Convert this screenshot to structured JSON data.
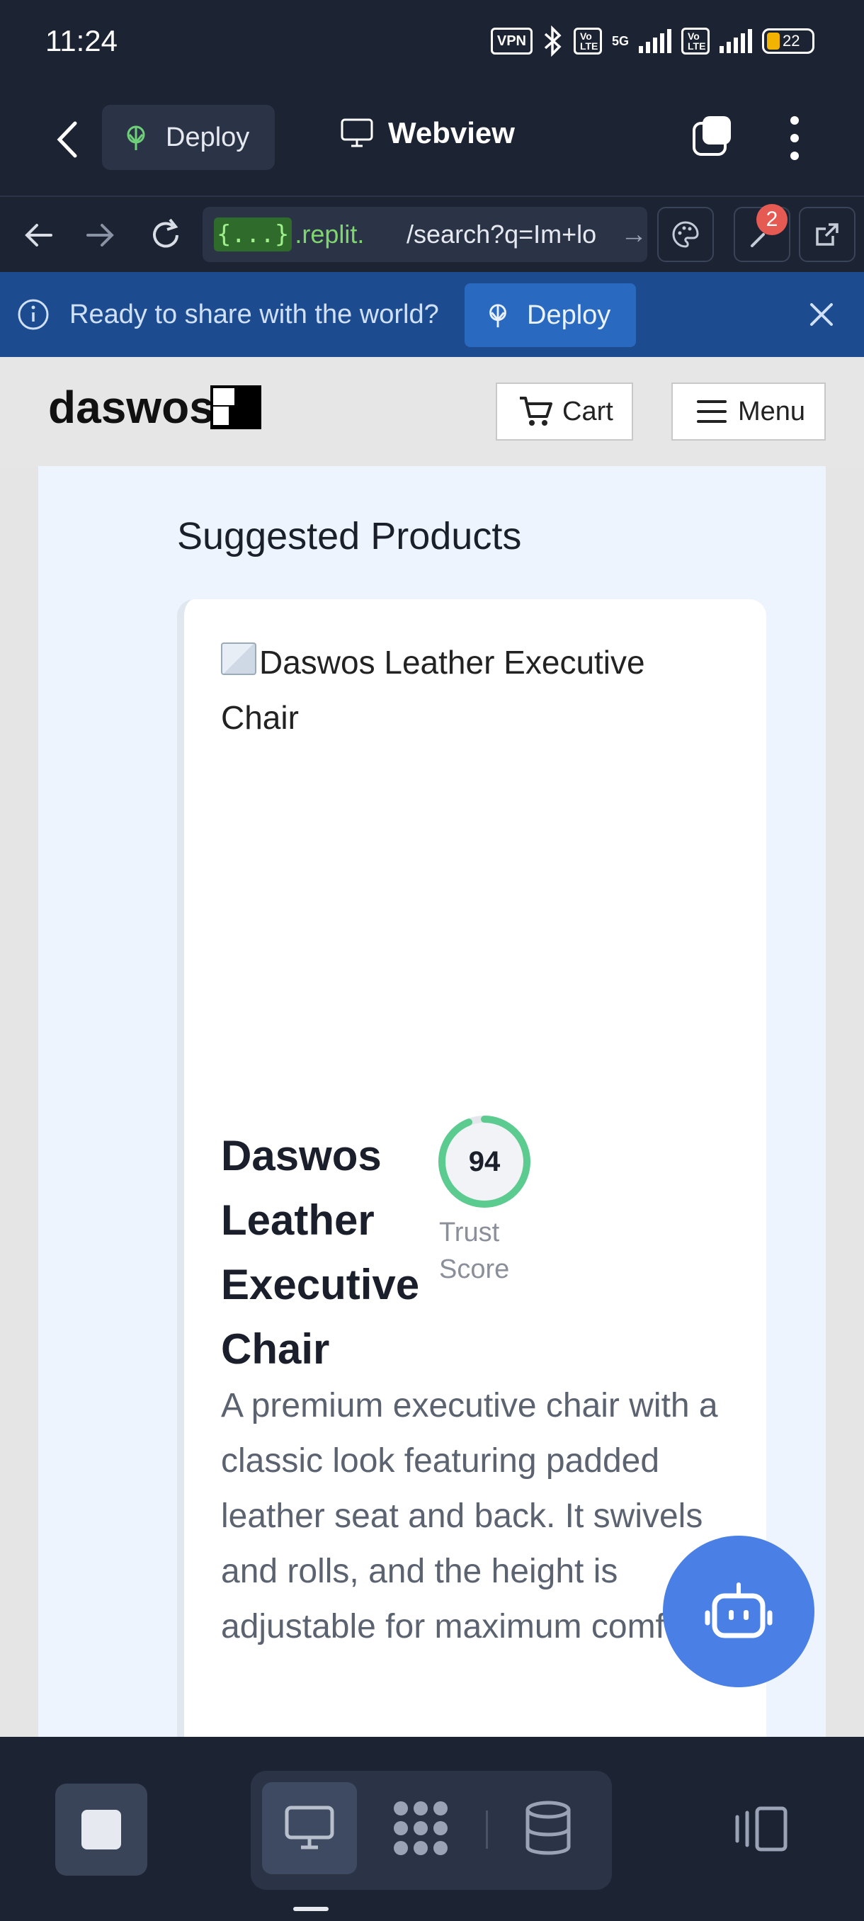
{
  "status_bar": {
    "time": "11:24",
    "vpn": "VPN",
    "lte1": "Vo LTE",
    "net": "5G",
    "lte2": "Vo LTE",
    "battery": "22"
  },
  "app_header": {
    "deploy_label": "Deploy",
    "webview_label": "Webview"
  },
  "browser": {
    "url_repl_tag": "{...}",
    "url_host": ".replit.",
    "url_path": "/search?q=Im+lo",
    "notification_count": "2"
  },
  "banner": {
    "text": "Ready to share with the world?",
    "deploy_label": "Deploy"
  },
  "site": {
    "logo": "daswos",
    "cart_label": "Cart",
    "menu_label": "Menu",
    "section_title": "Suggested Products",
    "product": {
      "image_alt": "Daswos Leather Executive Chair",
      "name": "Daswos Leather Executive Chair",
      "trust_score": 94,
      "trust_label": "Trust Score",
      "description": "A premium executive chair with a classic look featuring padded leather seat and back. It swivels and rolls, and the height is adjustable for maximum comfort."
    }
  },
  "colors": {
    "accent_blue": "#4a7fe6",
    "trust_green": "#5ccb8f",
    "banner_bg": "#1d4b8f",
    "dark_bg": "#1c2333"
  }
}
